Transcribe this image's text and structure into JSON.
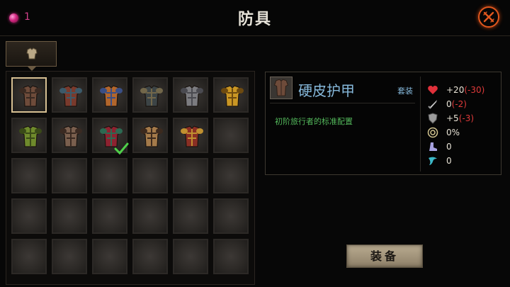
{
  "header": {
    "gem_count": "1",
    "title": "防具",
    "close_icon": "close-x-icon",
    "accent_color": "#e0571e"
  },
  "category_tab": {
    "icon": "armor-category-icon"
  },
  "inventory": {
    "rows": 5,
    "cols": 6,
    "items": [
      {
        "name": "硬皮护甲",
        "color": "#6e4b3a",
        "trim": "#3a2a22",
        "selected": true,
        "equipped": false
      },
      {
        "color": "#7a3a2c",
        "trim": "#3c5a6a",
        "selected": false,
        "equipped": false
      },
      {
        "color": "#b2662c",
        "trim": "#3a4f86",
        "selected": false,
        "equipped": false
      },
      {
        "color": "#3c4446",
        "trim": "#72674a",
        "selected": false,
        "equipped": false
      },
      {
        "color": "#7c7c80",
        "trim": "#4a4a50",
        "selected": false,
        "equipped": false
      },
      {
        "color": "#c99624",
        "trim": "#6d4a10",
        "selected": false,
        "equipped": false
      },
      {
        "color": "#6f8a2c",
        "trim": "#3a4a18",
        "selected": false,
        "equipped": false
      },
      {
        "color": "#7a5f4e",
        "trim": "#3a2a22",
        "selected": false,
        "equipped": false
      },
      {
        "color": "#8e2230",
        "trim": "#2c6a52",
        "selected": false,
        "equipped": true
      },
      {
        "color": "#a47a4a",
        "trim": "#3c2a1e",
        "selected": false,
        "equipped": false
      },
      {
        "color": "#8a2f24",
        "trim": "#c09030",
        "selected": false,
        "equipped": false
      }
    ]
  },
  "detail": {
    "name": "硬皮护甲",
    "set_label": "套装",
    "description": "初阶旅行者的标准配置",
    "name_color": "#86b9dc",
    "desc_color": "#53b85b",
    "stats": [
      {
        "icon": "heart-icon",
        "value": "+20",
        "delta": "(-30)"
      },
      {
        "icon": "sword-icon",
        "value": "0",
        "delta": "(-2)"
      },
      {
        "icon": "shield-icon",
        "value": "+5",
        "delta": "(-3)"
      },
      {
        "icon": "target-icon",
        "value": "0%",
        "delta": ""
      },
      {
        "icon": "boot-icon",
        "value": "0",
        "delta": ""
      },
      {
        "icon": "wing-icon",
        "value": "0",
        "delta": ""
      }
    ]
  },
  "equip_button": {
    "label": "装备"
  }
}
